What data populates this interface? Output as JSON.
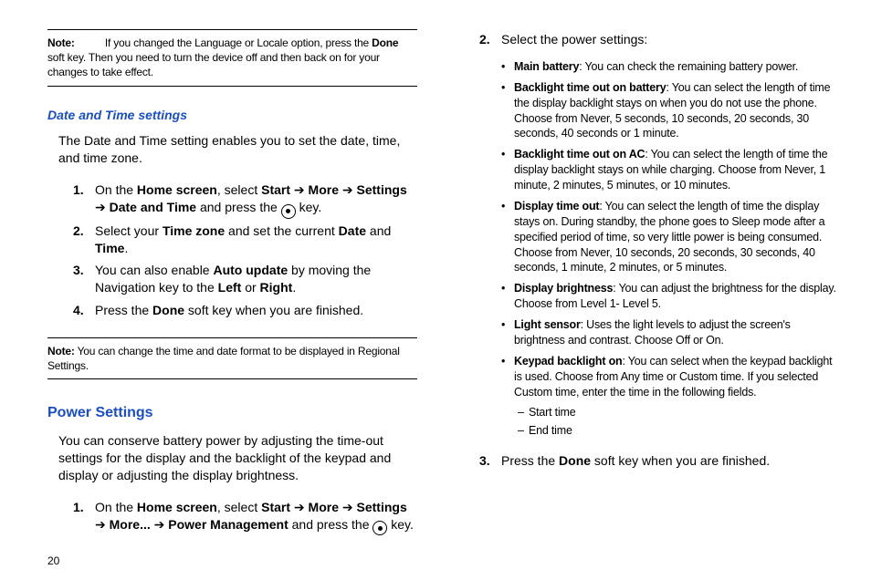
{
  "page_number": "20",
  "left": {
    "note1_label": "Note:",
    "note1": "If you changed the Language or Locale option, press the Done soft key. Then you need to turn the device off and then back on for your changes to take effect.",
    "h1": "Date and Time settings",
    "p1": "The Date and Time setting enables you to set the date, time, and time zone.",
    "step1_a": "On the ",
    "step1_home": "Home screen",
    "step1_b": ", select ",
    "step1_start": "Start",
    "step1_more": "More",
    "step1_settings": "Settings",
    "step1_dt": "Date and Time",
    "step1_c": " and press the ",
    "step1_d": " key.",
    "step2_a": "Select your ",
    "step2_tz": "Time zone",
    "step2_b": " and set the current ",
    "step2_date": "Date",
    "step2_and": " and ",
    "step2_time": "Time",
    "step2_dot": ".",
    "step3_a": "You can also enable ",
    "step3_au": "Auto update",
    "step3_b": " by moving the Navigation key to the ",
    "step3_left": "Left",
    "step3_or": " or ",
    "step3_right": "Right",
    "step3_dot": ".",
    "step4_a": "Press the ",
    "step4_done": "Done",
    "step4_b": " soft key when you are finished.",
    "note2_label": "Note:",
    "note2": "You can change the time and date format to be displayed in Regional Settings.",
    "h2": "Power Settings",
    "p2": "You can conserve battery power by adjusting the time-out settings for the display and the backlight of the keypad and display or adjusting the display brightness.",
    "ps1_a": "On the ",
    "ps1_home": "Home screen",
    "ps1_b": ", select ",
    "ps1_start": "Start",
    "ps1_more": "More",
    "ps1_settings": "Settings",
    "ps1_more2": "More...",
    "ps1_pm": "Power Management",
    "ps1_c": " and press the ",
    "ps1_d": " key."
  },
  "right": {
    "step2": "Select the power settings:",
    "b1_t": "Main battery",
    "b1": ": You can check the remaining battery power.",
    "b2_t": "Backlight time out on battery",
    "b2": ": You can select the length of time the display backlight stays on when you do not use the phone. Choose from Never, 5 seconds, 10 seconds, 20 seconds, 30 seconds, 40 seconds or 1 minute.",
    "b3_t": "Backlight time out on AC",
    "b3": ": You can select the length of time the display backlight stays on while charging. Choose from Never, 1 minute, 2 minutes, 5 minutes, or 10 minutes.",
    "b4_t": "Display time out",
    "b4": ": You can select the length of time the display stays on. During standby, the phone goes to Sleep mode after a specified period of time, so very little power is being consumed. Choose from Never, 10 seconds, 20 seconds, 30 seconds, 40 seconds, 1 minute, 2 minutes, or 5 minutes.",
    "b5_t": "Display brightness",
    "b5": ": You can adjust the brightness for the display. Choose from Level 1- Level 5.",
    "b6_t": "Light sensor",
    "b6": ": Uses the light levels to adjust the screen's brightness and contrast. Choose Off or On.",
    "b7_t": "Keypad backlight on",
    "b7": ": You can select when the keypad backlight is used. Choose from Any time or Custom time. If you selected Custom time, enter the time in the following fields.",
    "sub1": "Start time",
    "sub2": "End time",
    "step3_a": "Press the ",
    "step3_done": "Done",
    "step3_b": " soft key when you are finished."
  }
}
